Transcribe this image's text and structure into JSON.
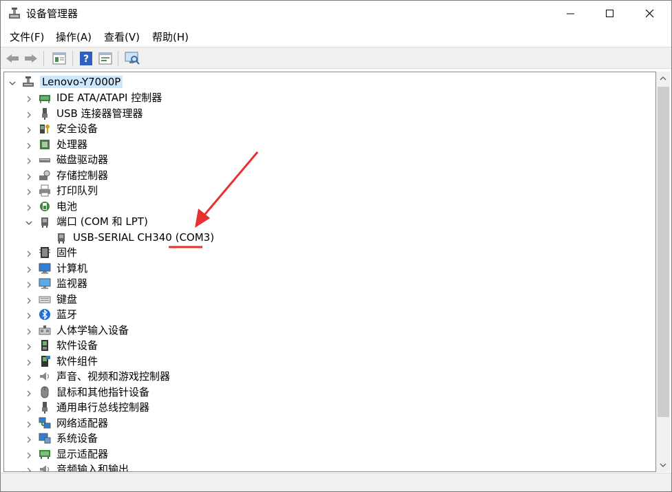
{
  "window": {
    "title": "设备管理器",
    "icon": "device-manager-icon"
  },
  "menu": [
    "文件(F)",
    "操作(A)",
    "查看(V)",
    "帮助(H)"
  ],
  "toolbar": {
    "buttons": [
      "back-arrow-icon",
      "forward-arrow-icon",
      "properties-icon",
      "help-icon",
      "update-driver-icon",
      "scan-hardware-icon"
    ]
  },
  "tree": {
    "root": "Lenovo-Y7000P",
    "categories": [
      {
        "label": "IDE ATA/ATAPI 控制器",
        "icon": "ide-controller-icon"
      },
      {
        "label": "USB 连接器管理器",
        "icon": "usb-connector-icon"
      },
      {
        "label": "安全设备",
        "icon": "security-device-icon"
      },
      {
        "label": "处理器",
        "icon": "processor-icon"
      },
      {
        "label": "磁盘驱动器",
        "icon": "disk-drive-icon"
      },
      {
        "label": "存储控制器",
        "icon": "storage-controller-icon"
      },
      {
        "label": "打印队列",
        "icon": "printer-icon"
      },
      {
        "label": "电池",
        "icon": "battery-icon"
      },
      {
        "label": "端口 (COM 和 LPT)",
        "icon": "port-icon",
        "expanded": true
      },
      {
        "label": "USB-SERIAL CH340 (COM3)",
        "icon": "serial-port-icon",
        "child": true
      },
      {
        "label": "固件",
        "icon": "firmware-icon"
      },
      {
        "label": "计算机",
        "icon": "computer-icon"
      },
      {
        "label": "监视器",
        "icon": "monitor-icon"
      },
      {
        "label": "键盘",
        "icon": "keyboard-icon"
      },
      {
        "label": "蓝牙",
        "icon": "bluetooth-icon"
      },
      {
        "label": "人体学输入设备",
        "icon": "hid-icon"
      },
      {
        "label": "软件设备",
        "icon": "software-device-icon"
      },
      {
        "label": "软件组件",
        "icon": "software-component-icon"
      },
      {
        "label": "声音、视频和游戏控制器",
        "icon": "sound-icon"
      },
      {
        "label": "鼠标和其他指针设备",
        "icon": "mouse-icon"
      },
      {
        "label": "通用串行总线控制器",
        "icon": "usb-controller-icon"
      },
      {
        "label": "网络适配器",
        "icon": "network-adapter-icon"
      },
      {
        "label": "系统设备",
        "icon": "system-device-icon"
      },
      {
        "label": "显示适配器",
        "icon": "display-adapter-icon"
      },
      {
        "label": "音频输入和输出",
        "icon": "audio-io-icon"
      }
    ]
  },
  "colors": {
    "selection": "#cce8ff",
    "annotation": "#e8312f"
  }
}
